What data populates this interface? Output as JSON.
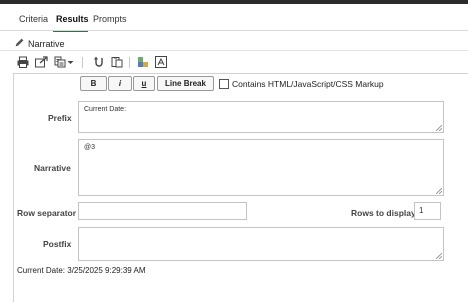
{
  "tabs": [
    {
      "label": "Criteria"
    },
    {
      "label": "Results"
    },
    {
      "label": "Prompts"
    }
  ],
  "view_title": "Narrative",
  "format_buttons": {
    "bold": "B",
    "italic": "i",
    "underline": "u",
    "line_break": "Line Break"
  },
  "markup_checkbox_label": "Contains HTML/JavaScript/CSS Markup",
  "markup_checked": false,
  "prefix": {
    "label": "Prefix",
    "value": "Current Date:"
  },
  "narrative": {
    "label": "Narrative",
    "value": "@3"
  },
  "row_separator": {
    "label": "Row separator",
    "value": ""
  },
  "rows_to_display": {
    "label": "Rows to display",
    "value": "1"
  },
  "postfix": {
    "label": "Postfix",
    "value": ""
  },
  "preview_text": "Current Date: 3/25/2025 9:29:39 AM",
  "colors": {
    "accent": "#3b6e47",
    "border": "#c4c4c4"
  }
}
